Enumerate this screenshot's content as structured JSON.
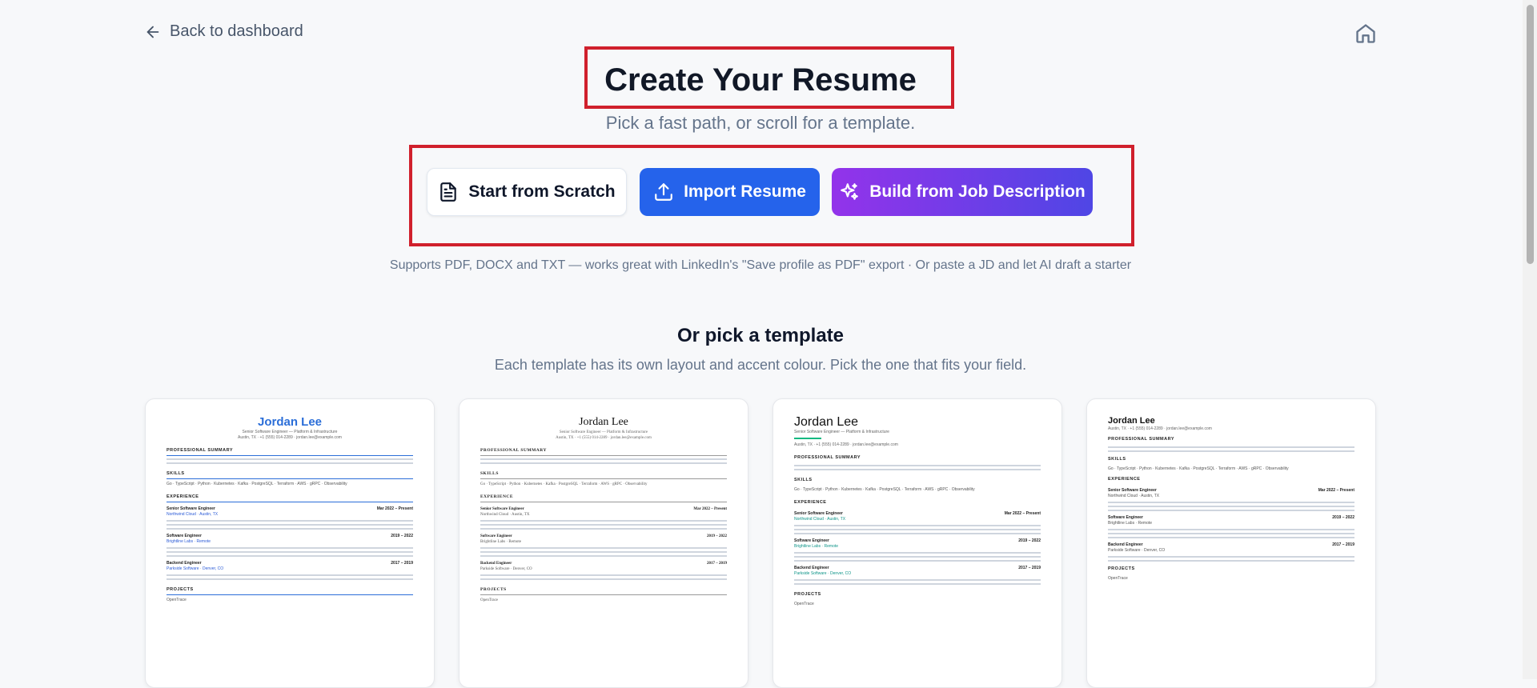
{
  "nav": {
    "back_label": "Back to dashboard"
  },
  "header": {
    "title": "Create Your Resume",
    "subtitle": "Pick a fast path, or scroll for a template."
  },
  "actions": {
    "scratch_label": "Start from Scratch",
    "import_label": "Import Resume",
    "jd_label": "Build from Job Description"
  },
  "support_text": "Supports PDF, DOCX and TXT — works great with LinkedIn's \"Save profile as PDF\" export · Or paste a JD and let AI draft a starter",
  "templates": {
    "title": "Or pick a template",
    "subtitle": "Each template has its own layout and accent colour. Pick the one that fits your field.",
    "sample": {
      "name": "Jordan Lee",
      "headline": "Senior Software Engineer — Platform & Infrastructure",
      "contact": "Austin, TX · +1 (555) 014-2289 · jordan.lee@example.com",
      "summary_heading": "PROFESSIONAL SUMMARY",
      "skills_heading": "SKILLS",
      "experience_heading": "EXPERIENCE",
      "projects_heading": "PROJECTS",
      "skills": "Go · TypeScript · Python · Kubernetes · Kafka · PostgreSQL · Terraform · AWS · gRPC · Observability",
      "jobs": [
        {
          "title": "Senior Software Engineer",
          "company": "Northwind Cloud · Austin, TX",
          "dates": "Mar 2022 – Present"
        },
        {
          "title": "Software Engineer",
          "company": "Brightline Labs · Remote",
          "dates": "2019 – 2022"
        },
        {
          "title": "Backend Engineer",
          "company": "Parkside Software · Denver, CO",
          "dates": "2017 – 2019"
        }
      ],
      "project": "OpenTrace"
    }
  },
  "colors": {
    "primary": "#2563eb",
    "gradient_start": "#9333ea",
    "gradient_end": "#4f46e5",
    "highlight_border": "#d0202c"
  }
}
